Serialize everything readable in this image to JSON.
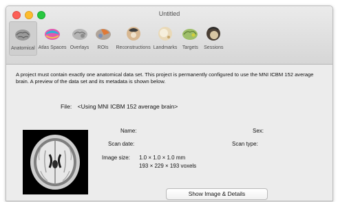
{
  "window": {
    "title": "Untitled"
  },
  "toolbar": {
    "items": [
      {
        "label": "Anatomical",
        "icon": "brain-gray-icon",
        "selected": true
      },
      {
        "label": "Atlas Spaces",
        "icon": "brain-colored-icon",
        "selected": false
      },
      {
        "label": "Overlays",
        "icon": "brain-overlay-icon",
        "selected": false
      },
      {
        "label": "ROIs",
        "icon": "brain-roi-icon",
        "selected": false
      },
      {
        "label": "Reconstructions",
        "icon": "head-reconstruction-icon",
        "selected": false
      },
      {
        "label": "Landmarks",
        "icon": "head-landmarks-icon",
        "selected": false
      },
      {
        "label": "Targets",
        "icon": "brain-targets-icon",
        "selected": false
      },
      {
        "label": "Sessions",
        "icon": "head-sessions-icon",
        "selected": false
      }
    ]
  },
  "main": {
    "description": "A project must contain exactly one anatomical data set. This project is permanently configured to use the MNI ICBM 152 average brain. A preview of the data set and its metadata is shown below.",
    "file_label": "File:",
    "file_value": "<Using MNI ICBM 152 average brain>",
    "fields": {
      "name_label": "Name:",
      "sex_label": "Sex:",
      "scan_date_label": "Scan date:",
      "scan_type_label": "Scan type:",
      "image_size_label": "Image size:",
      "image_size_mm": "1.0 × 1.0 × 1.0 mm",
      "image_size_voxels": "193 × 229 × 193 voxels"
    },
    "show_button": "Show Image & Details"
  }
}
